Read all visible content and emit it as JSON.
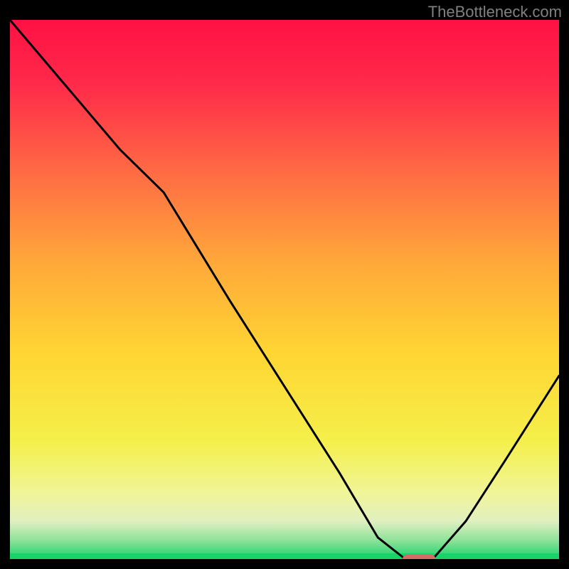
{
  "watermark": "TheBottleneck.com",
  "chart_data": {
    "type": "line",
    "title": "",
    "xlabel": "",
    "ylabel": "",
    "xlim": [
      0,
      100
    ],
    "ylim": [
      0,
      100
    ],
    "background": {
      "type": "vertical-gradient",
      "stops": [
        {
          "pos": 0.0,
          "color": "#ff1144"
        },
        {
          "pos": 0.12,
          "color": "#ff2a4a"
        },
        {
          "pos": 0.28,
          "color": "#ff6a44"
        },
        {
          "pos": 0.45,
          "color": "#ffa83a"
        },
        {
          "pos": 0.62,
          "color": "#ffd633"
        },
        {
          "pos": 0.78,
          "color": "#f5ef4a"
        },
        {
          "pos": 0.88,
          "color": "#f0f59a"
        },
        {
          "pos": 0.93,
          "color": "#e0f0c0"
        },
        {
          "pos": 0.965,
          "color": "#8fe29a"
        },
        {
          "pos": 1.0,
          "color": "#18d36a"
        }
      ]
    },
    "series": [
      {
        "name": "curve",
        "color": "#000000",
        "x": [
          0,
          10,
          20,
          28,
          40,
          50,
          60,
          67,
          72,
          77,
          83,
          90,
          100
        ],
        "y": [
          100,
          88,
          76,
          68,
          48,
          32,
          16,
          4,
          0,
          0,
          7,
          18,
          34
        ]
      }
    ],
    "marker": {
      "name": "pill-marker",
      "x_center": 74.5,
      "y": 0,
      "width_x": 6,
      "color": "#d46a6a"
    },
    "grid": false,
    "legend": false
  }
}
